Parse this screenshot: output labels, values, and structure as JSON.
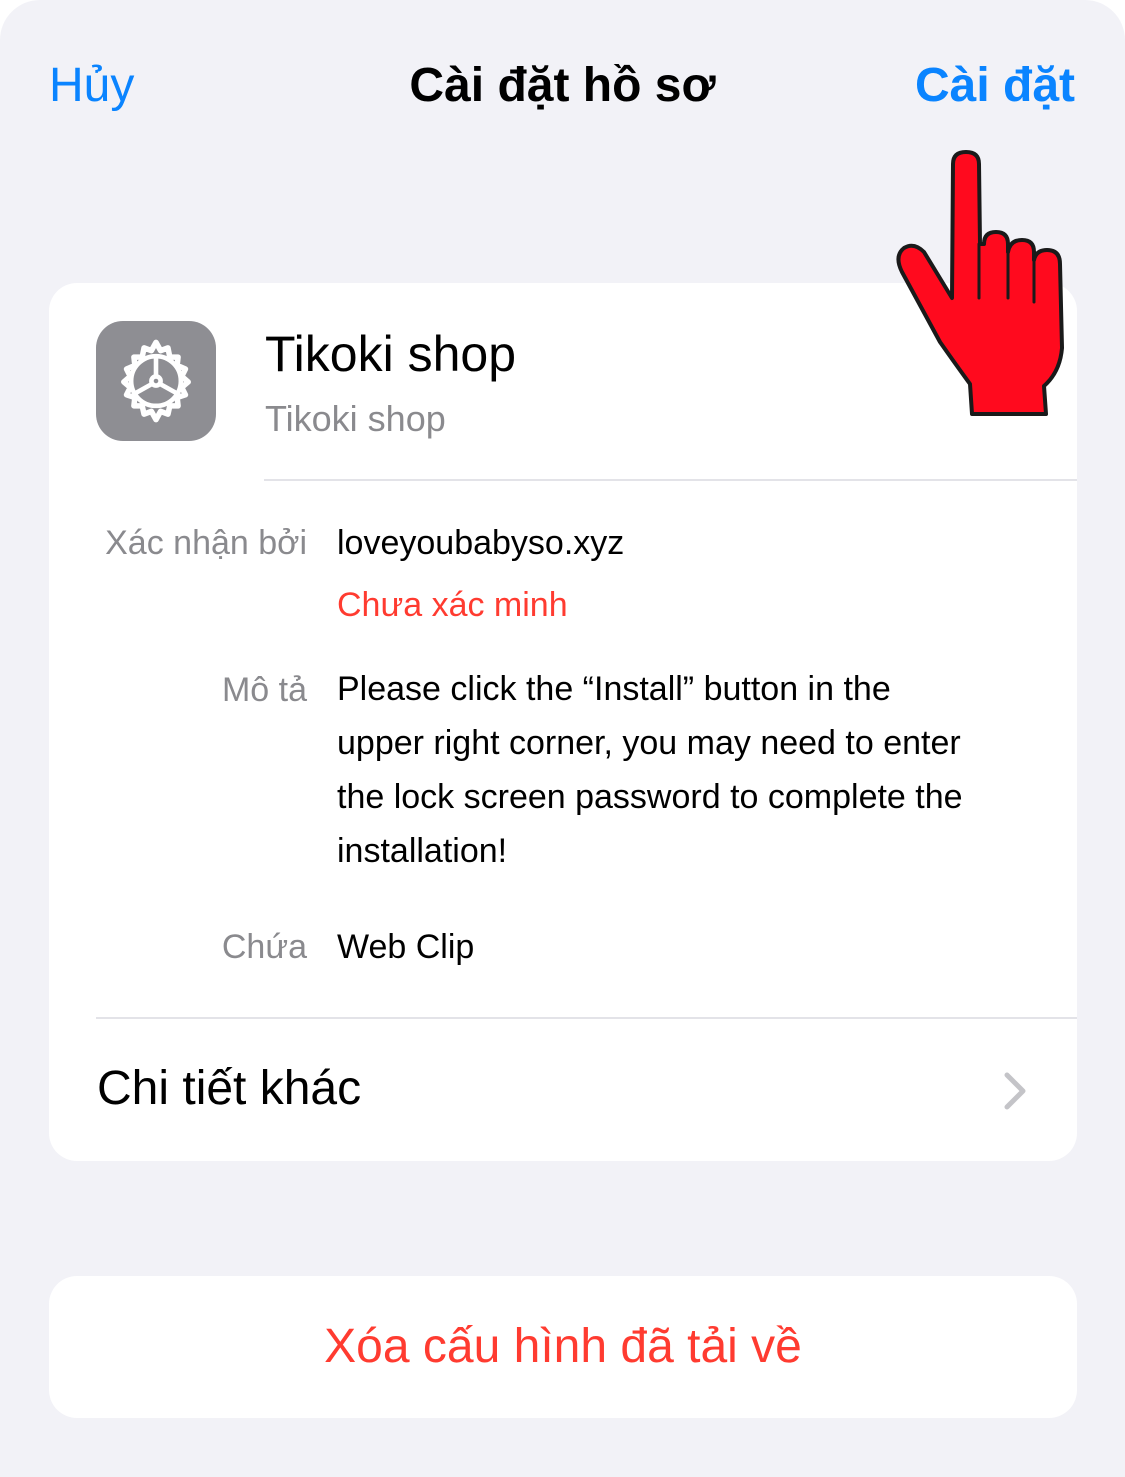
{
  "nav": {
    "cancel": "Hủy",
    "title": "Cài đặt hồ sơ",
    "install": "Cài đặt"
  },
  "profile": {
    "name": "Tikoki shop",
    "subtitle": "Tikoki shop",
    "icon": "gear-icon"
  },
  "details": {
    "verified_by_label": "Xác nhận bởi",
    "verified_by_value": "loveyoubabyso.xyz",
    "verification_status": "Chưa xác minh",
    "description_label": "Mô tả",
    "description_lines": [
      "Please click the “Install” button in the",
      "upper right corner, you may need to enter",
      "the lock screen password to complete the",
      "installation!"
    ],
    "contains_label": "Chứa",
    "contains_value": "Web Clip"
  },
  "more_details": {
    "label": "Chi tiết khác",
    "icon": "chevron-right-icon"
  },
  "delete": {
    "label": "Xóa cấu hình đã tải về"
  },
  "overlay": {
    "icon": "pointing-hand-icon"
  },
  "colors": {
    "accent_blue": "#0a84ff",
    "destructive_red": "#ff3b30",
    "background": "#f2f2f7",
    "hand_red": "#ff0a1e"
  }
}
